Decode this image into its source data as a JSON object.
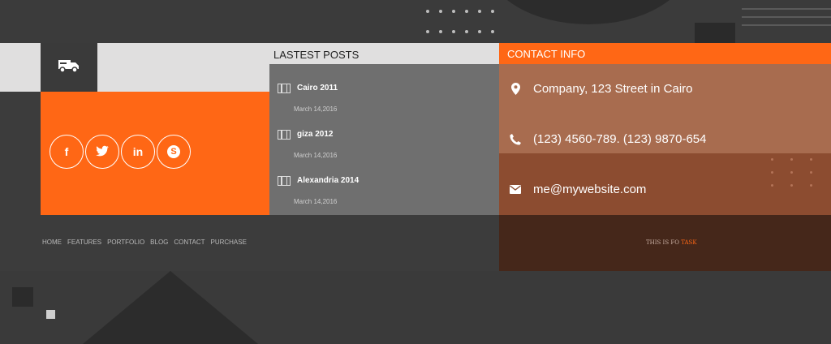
{
  "posts": {
    "heading": "LASTEST POSTS",
    "items": [
      {
        "title": "Cairo 2011",
        "date": "March 14,2016"
      },
      {
        "title": "giza 2012",
        "date": "March 14,2016"
      },
      {
        "title": "Alexandria 2014",
        "date": "March 14,2016"
      }
    ]
  },
  "contact": {
    "heading": "CONTACT INFO",
    "address": "Company, 123 Street in Cairo",
    "phone": "(123) 4560-789. (123) 9870-654",
    "email": "me@mywebsite.com"
  },
  "social": {
    "facebook": "f",
    "twitter_icon": "twitter-icon",
    "linkedin": "in",
    "skype": "S"
  },
  "footer": {
    "nav": [
      "HOME",
      "FEATURES",
      "PORTFOLIO",
      "BLOG",
      "CONTACT",
      "PURCHASE"
    ],
    "copyright_text": "THIS IS FO",
    "copyright_accent": "TASK"
  },
  "colors": {
    "accent": "#ff6715",
    "dark": "#3b3b3b",
    "contact_bg": "#a86c4f"
  }
}
